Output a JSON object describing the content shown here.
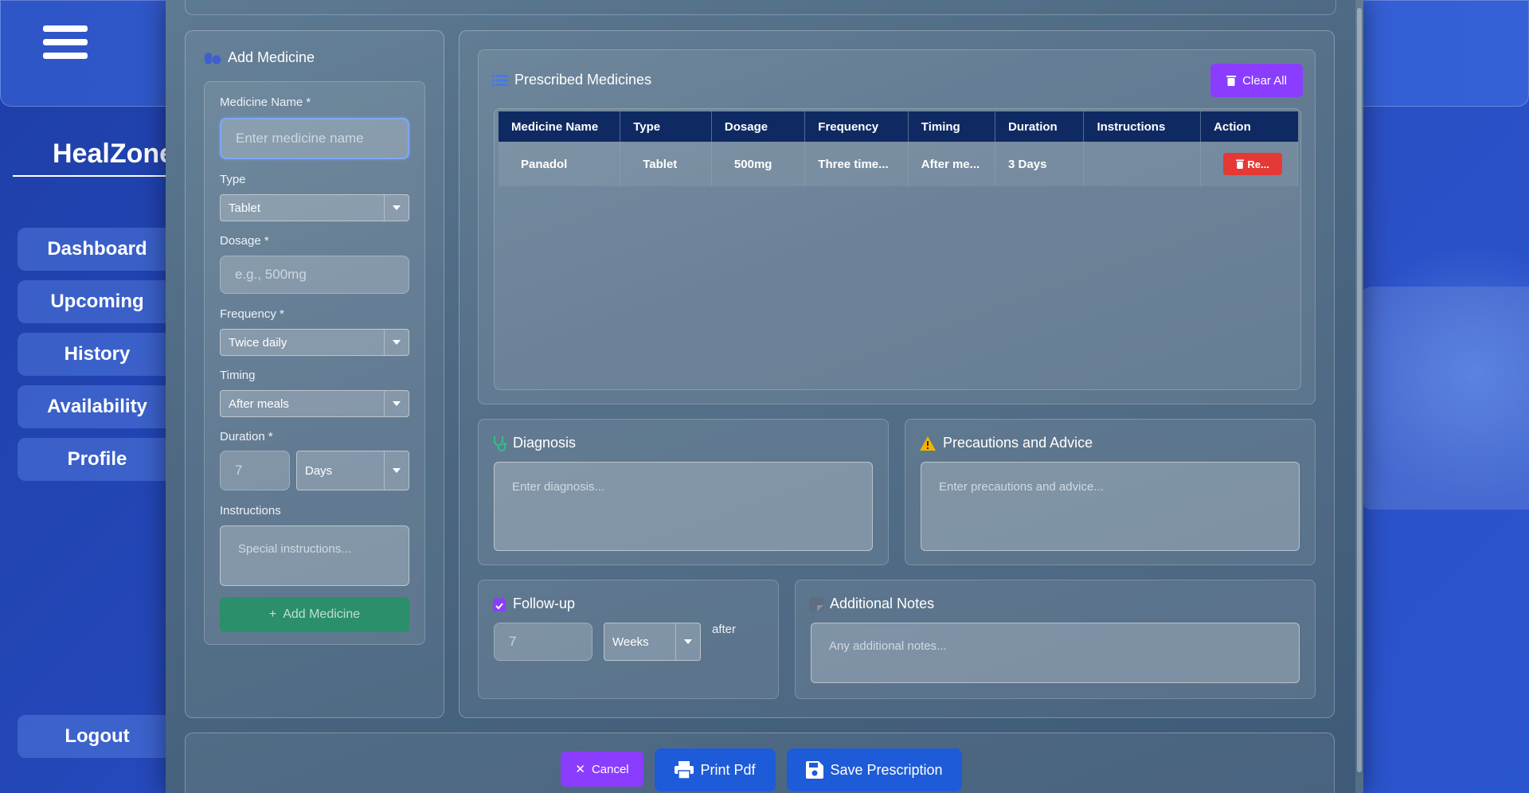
{
  "sidebar": {
    "brand": "HealZone",
    "items": [
      {
        "label": "Dashboard"
      },
      {
        "label": "Upcoming"
      },
      {
        "label": "History"
      },
      {
        "label": "Availability"
      },
      {
        "label": "Profile"
      }
    ],
    "logout": "Logout"
  },
  "add_medicine": {
    "title": "Add Medicine",
    "name_label": "Medicine Name *",
    "name_placeholder": "Enter medicine name",
    "type_label": "Type",
    "type_value": "Tablet",
    "dosage_label": "Dosage *",
    "dosage_placeholder": "e.g., 500mg",
    "frequency_label": "Frequency *",
    "frequency_value": "Twice daily",
    "timing_label": "Timing",
    "timing_value": "After meals",
    "duration_label": "Duration *",
    "duration_value": "7",
    "duration_unit": "Days",
    "instructions_label": "Instructions",
    "instructions_placeholder": "Special instructions...",
    "add_button": "Add Medicine"
  },
  "prescribed": {
    "title": "Prescribed Medicines",
    "clear_all": "Clear All",
    "columns": [
      "Medicine Name",
      "Type",
      "Dosage",
      "Frequency",
      "Timing",
      "Duration",
      "Instructions",
      "Action"
    ],
    "rows": [
      {
        "name": "Panadol",
        "type": "Tablet",
        "dosage": "500mg",
        "frequency": "Three time...",
        "timing": "After me...",
        "duration": "3 Days",
        "instructions": "",
        "action": "Re..."
      }
    ]
  },
  "diagnosis": {
    "title": "Diagnosis",
    "placeholder": "Enter diagnosis..."
  },
  "precautions": {
    "title": "Precautions and Advice",
    "placeholder": "Enter precautions and advice..."
  },
  "followup": {
    "title": "Follow-up",
    "value": "7",
    "unit": "Weeks",
    "after": "after"
  },
  "notes": {
    "title": "Additional Notes",
    "placeholder": "Any additional notes..."
  },
  "footer": {
    "cancel": "Cancel",
    "print": "Print Pdf",
    "save": "Save Prescription"
  },
  "colors": {
    "accent_purple": "#8b3dff",
    "accent_green": "#2a8f6a",
    "accent_blue": "#1e5bd8",
    "danger": "#e53935",
    "table_header": "#0f2a63"
  }
}
